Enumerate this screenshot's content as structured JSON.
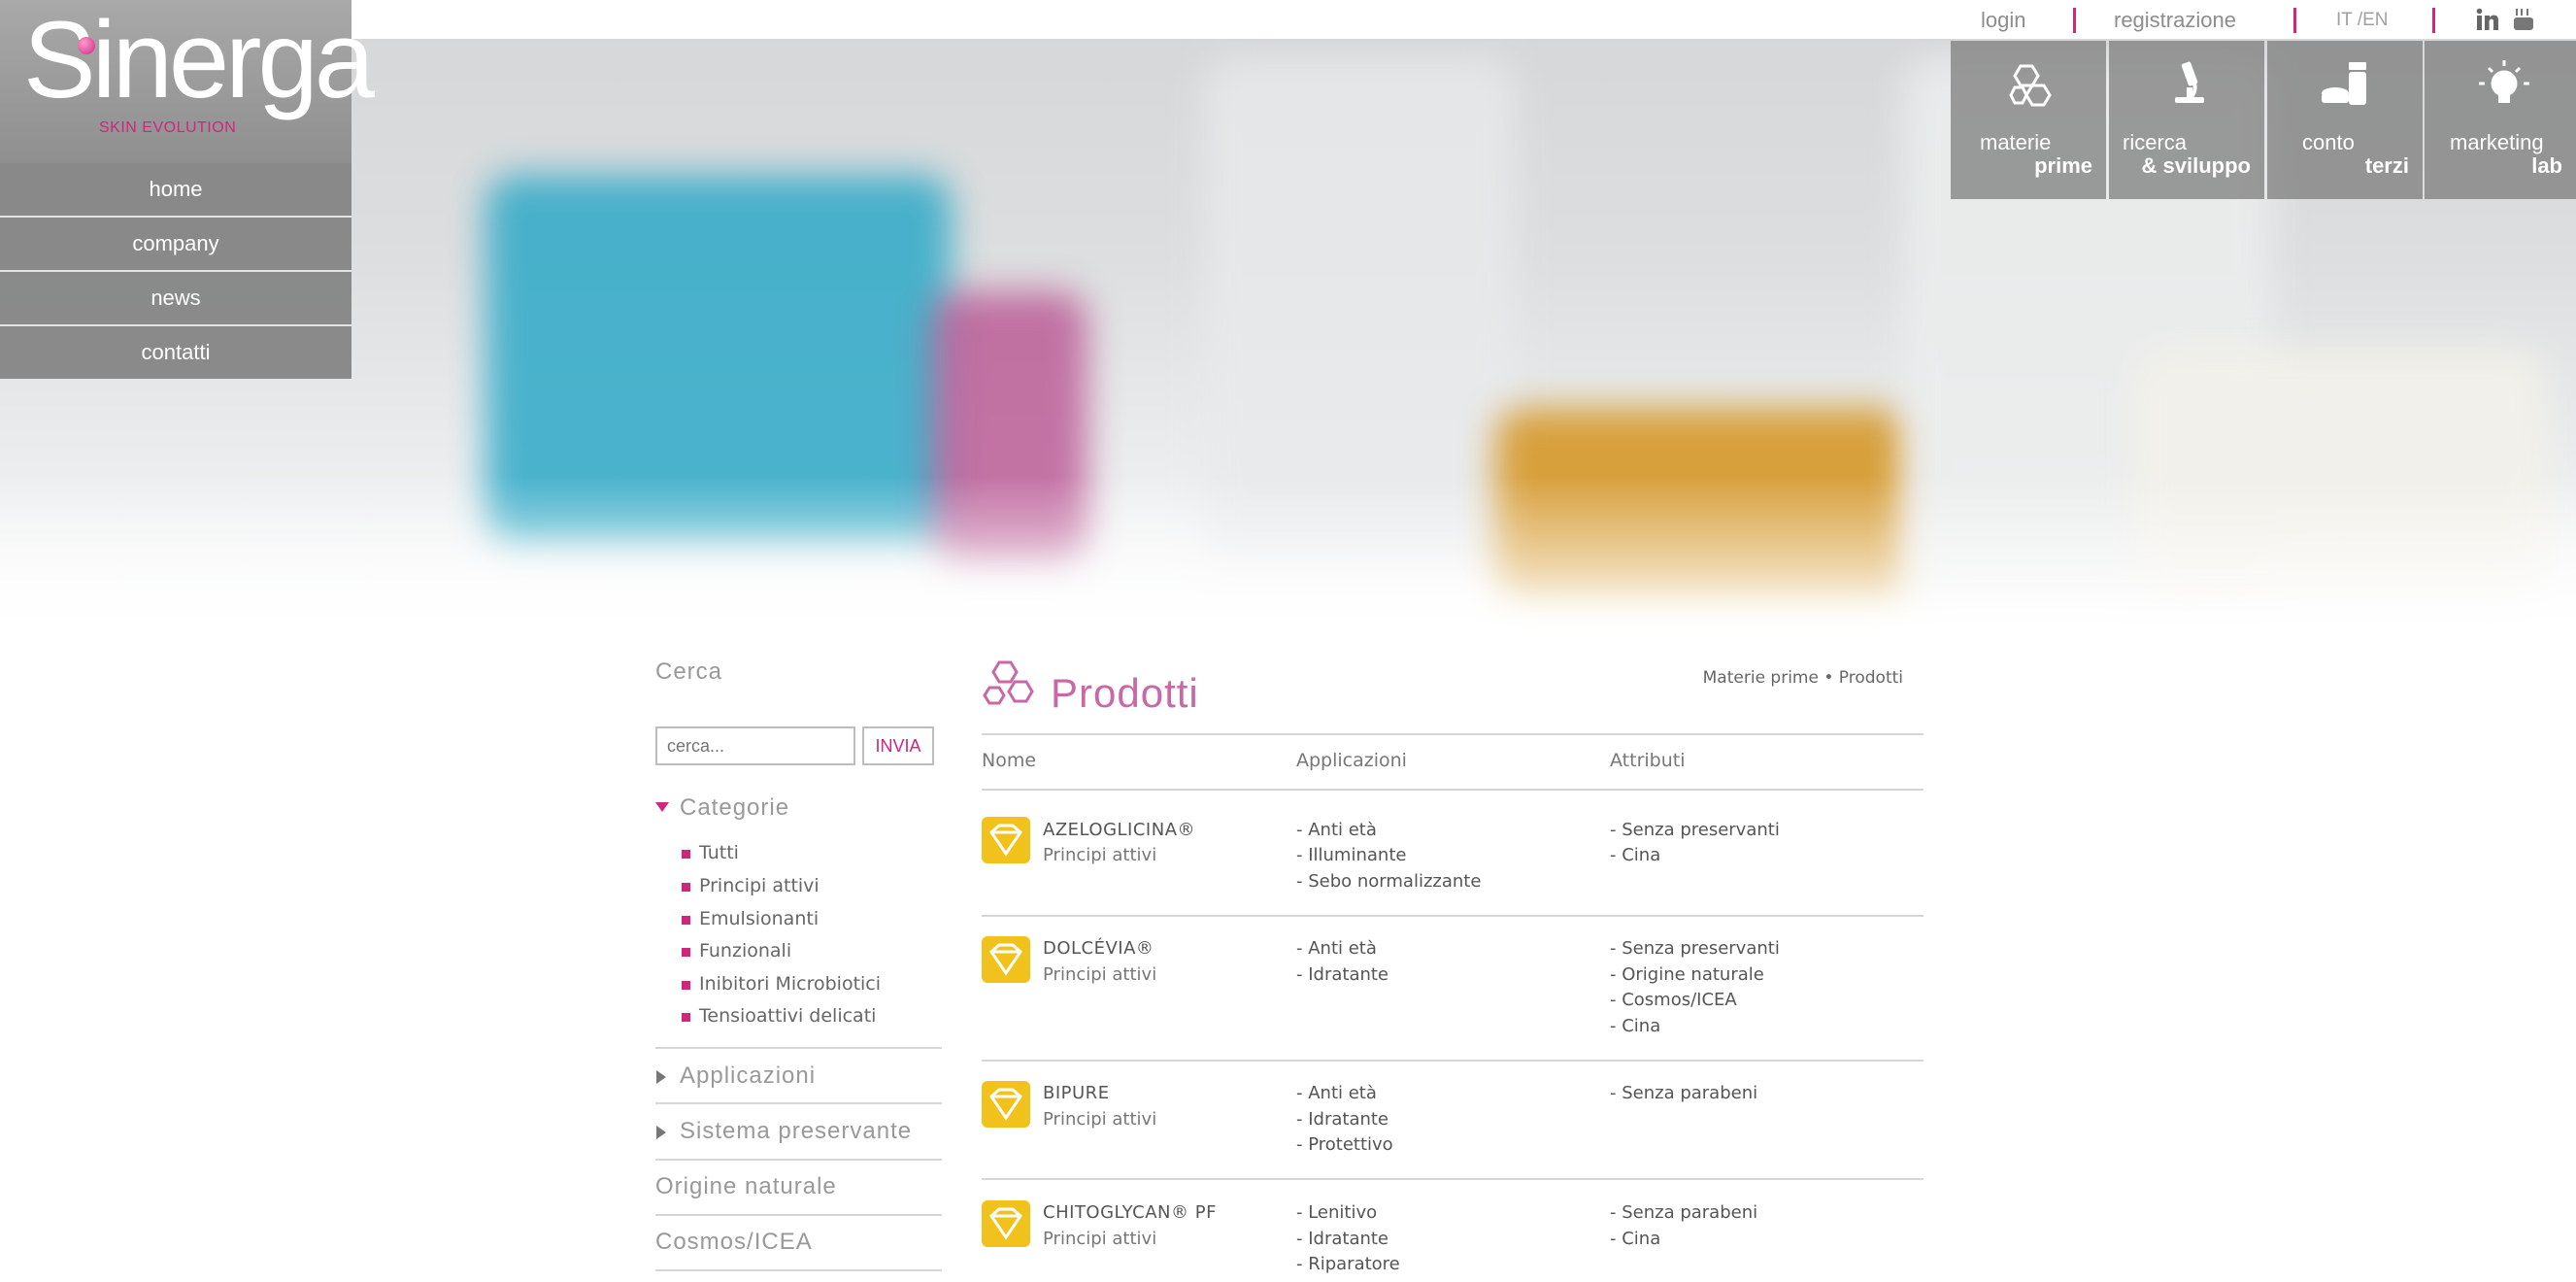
{
  "brand": {
    "logo_text": "Sinerga",
    "tagline": "SKIN EVOLUTION"
  },
  "top_bar": {
    "login": "login",
    "register": "registrazione",
    "language": "IT /EN",
    "social": [
      "linkedin-icon",
      "youtube-icon"
    ]
  },
  "left_nav": {
    "items": [
      "home",
      "company",
      "news",
      "contatti"
    ]
  },
  "big_menu": [
    {
      "line1": "materie",
      "line2": "prime",
      "icon": "molecule-icon"
    },
    {
      "line1": "ricerca",
      "line2": "& sviluppo",
      "icon": "microscope-icon"
    },
    {
      "line1": "conto",
      "line2": "terzi",
      "icon": "cosmetics-icon"
    },
    {
      "line1": "marketing",
      "line2": "lab",
      "icon": "lightbulb-icon"
    }
  ],
  "sidebar": {
    "search_title": "Cerca",
    "search_placeholder": "cerca...",
    "search_button": "INVIA",
    "categories_title": "Categorie",
    "categories": [
      "Tutti",
      "Principi attivi",
      "Emulsionanti",
      "Funzionali",
      "Inibitori Microbiotici",
      "Tensioattivi delicati"
    ],
    "applications_title": "Applicazioni",
    "preservatives_title": "Sistema preservante",
    "natural_title": "Origine naturale",
    "cosmos_title": "Cosmos/ICEA"
  },
  "main": {
    "title": "Prodotti",
    "breadcrumb": "Materie prime • Prodotti",
    "columns": [
      "Nome",
      "Applicazioni",
      "Attributi"
    ],
    "products": [
      {
        "name": "AZELOGLICINA®",
        "category": "Principi attivi",
        "applications": [
          "- Anti età",
          "- Illuminante",
          "- Sebo normalizzante"
        ],
        "attributes": [
          "- Senza preservanti",
          "- Cina"
        ]
      },
      {
        "name": "DOLCÉVIA®",
        "category": "Principi attivi",
        "applications": [
          "- Anti età",
          "- Idratante"
        ],
        "attributes": [
          "- Senza preservanti",
          "- Origine naturale",
          "- Cosmos/ICEA",
          "- Cina"
        ]
      },
      {
        "name": "BIPURE",
        "category": "Principi attivi",
        "applications": [
          "- Anti età",
          "- Idratante",
          "- Protettivo"
        ],
        "attributes": [
          "- Senza parabeni"
        ]
      },
      {
        "name": "CHITOGLYCAN® PF",
        "category": "Principi attivi",
        "applications": [
          "- Lenitivo",
          "- Idratante",
          "- Riparatore"
        ],
        "attributes": [
          "- Senza parabeni",
          "- Cina"
        ]
      }
    ]
  },
  "colors": {
    "accent": "#d0267c",
    "title_pink": "#c868a6",
    "product_icon": "#f1c21b",
    "nav_gray": "#7d7d7d"
  }
}
